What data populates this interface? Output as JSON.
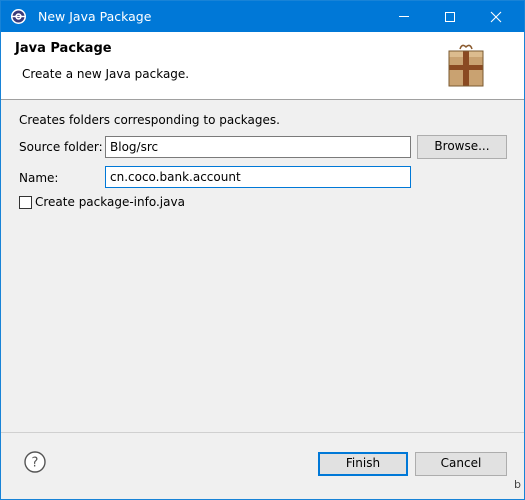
{
  "window": {
    "title": "New Java Package"
  },
  "header": {
    "title": "Java Package",
    "description": "Create a new Java package."
  },
  "body": {
    "intro": "Creates folders corresponding to packages.",
    "source_folder": {
      "label": "Source folder:",
      "value": "Blog/src",
      "browse_label": "Browse..."
    },
    "name": {
      "label": "Name:",
      "value": "cn.coco.bank.account"
    },
    "package_info": {
      "label": "Create package-info.java",
      "checked": false
    }
  },
  "footer": {
    "finish_label": "Finish",
    "cancel_label": "Cancel"
  },
  "edge_glyph": "b",
  "colors": {
    "titlebar": "#0078d7",
    "focus_border": "#0078d7",
    "button": "#e1e1e1"
  },
  "icons": [
    "eclipse-app-icon",
    "minimize-icon",
    "maximize-icon",
    "close-icon",
    "package-icon",
    "help-icon"
  ]
}
